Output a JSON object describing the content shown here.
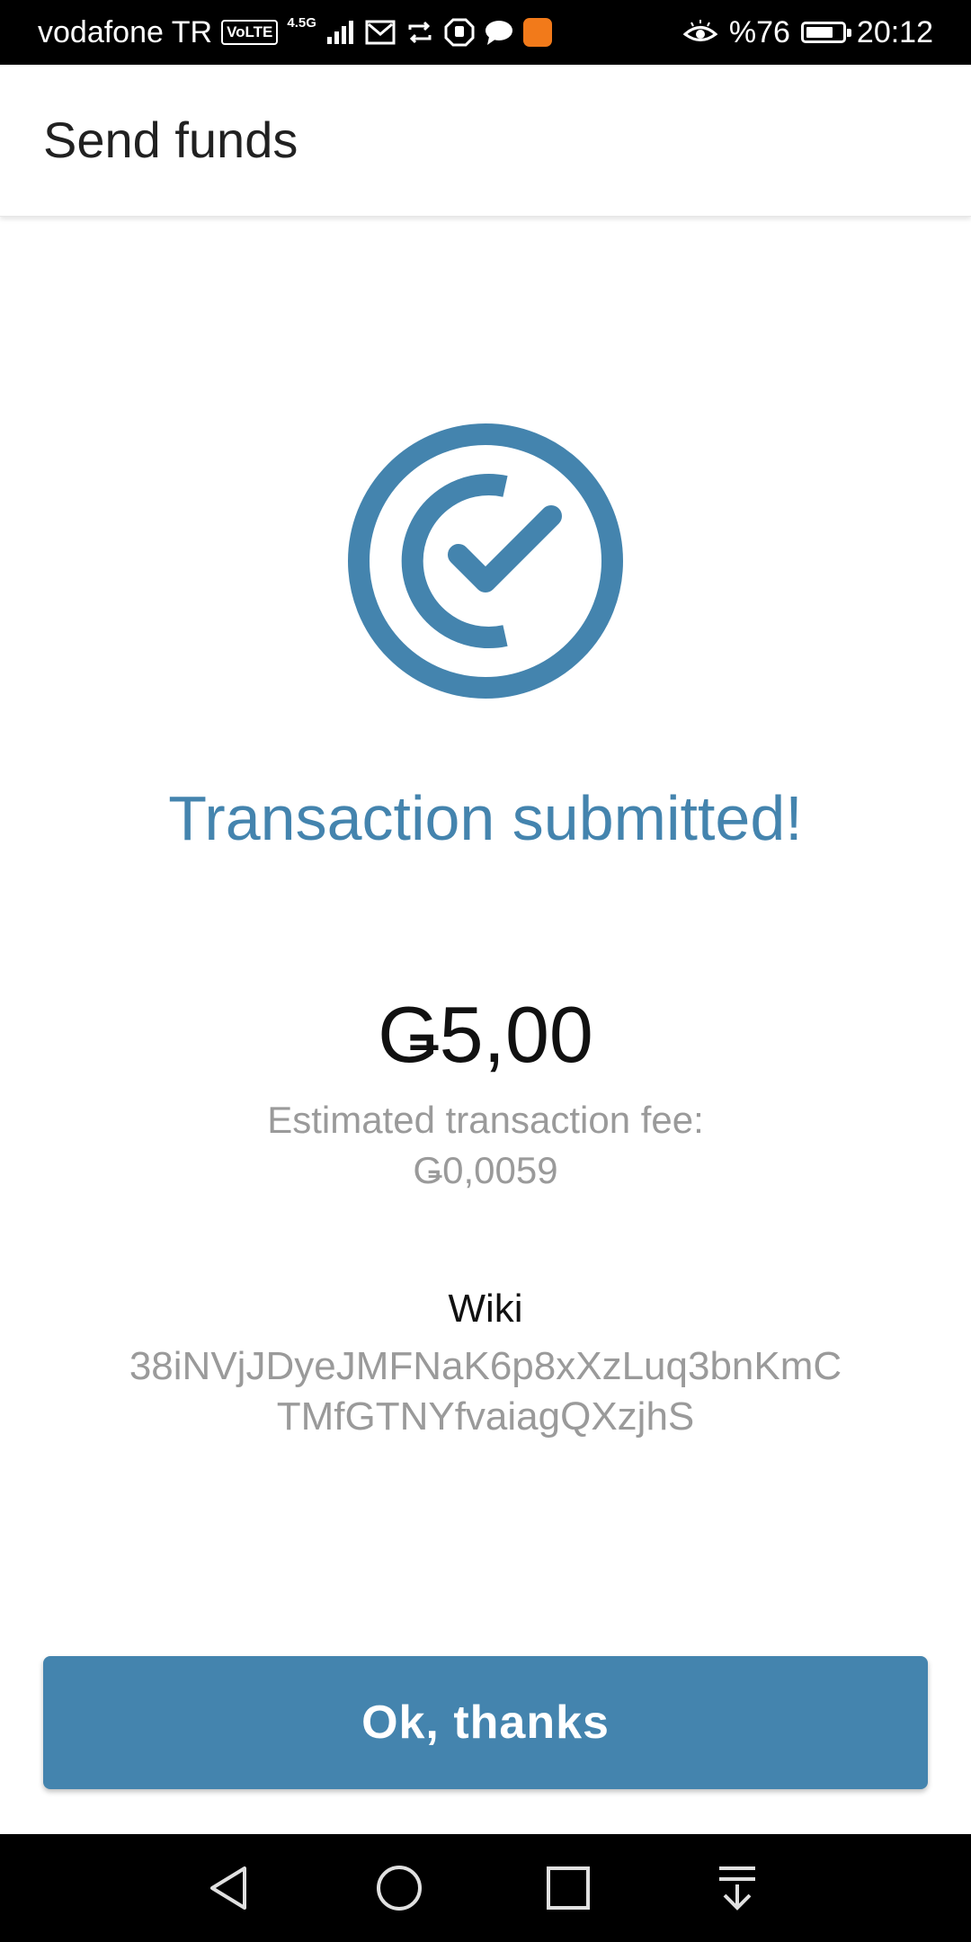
{
  "status_bar": {
    "carrier": "vodafone TR",
    "volte": "VoLTE",
    "network": "4.5G",
    "battery_percent": "%76",
    "battery_level": 0.76,
    "time": "20:12",
    "notification_icons": [
      "gmail-icon",
      "sync-icon",
      "hand-icon",
      "chat-icon",
      "app-notification-icon"
    ]
  },
  "header": {
    "title": "Send funds"
  },
  "result": {
    "headline": "Transaction submitted!",
    "amount": "Ǥ5,00",
    "fee_label": "Estimated transaction fee:",
    "fee_value": "Ǥ0,0059",
    "recipient_name": "Wiki",
    "address_line1": "38iNVjJDyeJMFNaK6p8xXzLuq3bnKmC",
    "address_line2": "TMfGTNYfvaiagQXzjhS"
  },
  "actions": {
    "confirm_label": "Ok, thanks"
  },
  "colors": {
    "accent": "#4484ae",
    "status_bar": "#000000",
    "nav_bar": "#000000",
    "secondary_text": "#9a9a9a"
  },
  "nav": {
    "icons": [
      "back-icon",
      "home-icon",
      "recents-icon",
      "notification-drawer-icon"
    ]
  }
}
